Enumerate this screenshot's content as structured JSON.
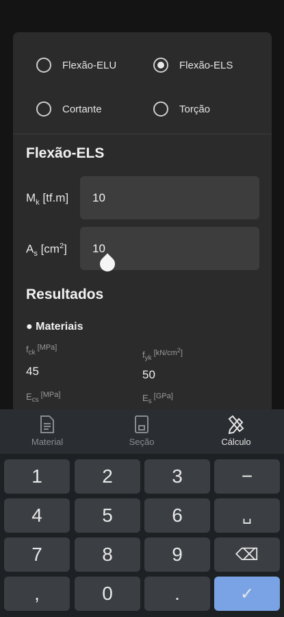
{
  "options": {
    "flexao_elu": "Flexão-ELU",
    "flexao_els": "Flexão-ELS",
    "cortante": "Cortante",
    "torcao": "Torção",
    "selected": "flexao_els"
  },
  "section": {
    "title": "Flexão-ELS",
    "mk": {
      "symbol": "M",
      "sub": "k",
      "unit": "[tf.m]",
      "value": "10"
    },
    "as": {
      "symbol": "A",
      "sub": "s",
      "unit_pre": "[cm",
      "unit_sup": "2",
      "unit_post": "]",
      "value": "10"
    }
  },
  "results": {
    "title": "Resultados",
    "materials_title": "● Materiais",
    "fck": {
      "symbol": "f",
      "sub": "ck",
      "unit": "[MPa]",
      "value": "45"
    },
    "fyk": {
      "symbol": "f",
      "sub": "yk",
      "unit_pre": "[kN/cm",
      "unit_sup": "2",
      "unit_post": "]",
      "value": "50"
    },
    "ecs": {
      "symbol": "E",
      "sub": "cs",
      "unit": "[MPa]"
    },
    "es": {
      "symbol": "E",
      "sub": "s",
      "unit": "[GPa]"
    }
  },
  "tabs": {
    "material": "Material",
    "secao": "Seção",
    "calculo": "Cálculo",
    "active": "calculo"
  },
  "keyboard": {
    "k1": "1",
    "k2": "2",
    "k3": "3",
    "minus": "−",
    "k4": "4",
    "k5": "5",
    "k6": "6",
    "space": "␣",
    "k7": "7",
    "k8": "8",
    "k9": "9",
    "backspace": "⌫",
    "comma": ",",
    "k0": "0",
    "dot": ".",
    "confirm": "✓"
  }
}
